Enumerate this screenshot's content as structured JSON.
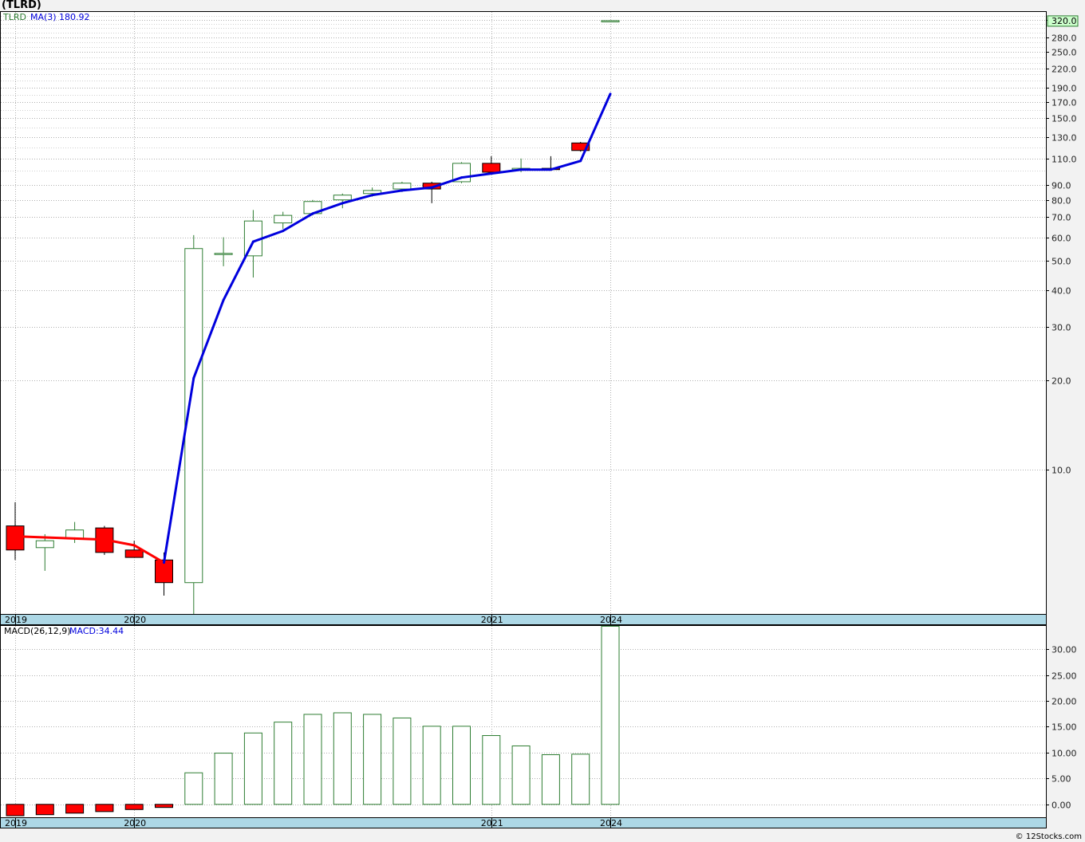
{
  "header": {
    "title": "(TLRD)"
  },
  "price_panel": {
    "symbol": "TLRD",
    "ma_label": "MA(3)",
    "ma_value": "180.92",
    "last_price_badge": "320.0"
  },
  "macd_panel": {
    "label": "MACD(26,12,9)",
    "value_label": "MACD:34.44"
  },
  "footer": {
    "copyright": "© 12Stocks.com"
  },
  "colors": {
    "up_candle": "#2e7d32",
    "down_candle": "#ff0000",
    "ma_up": "#0000dd",
    "ma_down": "#ff0000",
    "axis_band": "#add8e6",
    "badge_bg": "#ccffcc"
  },
  "chart_data": [
    {
      "type": "candlestick",
      "scale": "log",
      "ylim": [
        3.3,
        340
      ],
      "yticks": [
        "10.0",
        "20.0",
        "30.0",
        "40.0",
        "50.0",
        "60.0",
        "70.0",
        "80.0",
        "90.0",
        "110.0",
        "130.0",
        "150.0",
        "170.0",
        "190.0",
        "220.0",
        "250.0",
        "280.0",
        "320.0"
      ],
      "x_axis_labels": [
        {
          "label": "2019",
          "index": 0
        },
        {
          "label": "2020",
          "index": 4
        },
        {
          "label": "2021",
          "index": 16
        },
        {
          "label": "2024",
          "index": 20
        }
      ],
      "candles": [
        {
          "open": 6.5,
          "high": 7.8,
          "low": 5.0,
          "close": 5.4
        },
        {
          "open": 5.5,
          "high": 6.1,
          "low": 4.6,
          "close": 5.8
        },
        {
          "open": 5.9,
          "high": 6.7,
          "low": 5.7,
          "close": 6.3
        },
        {
          "open": 6.4,
          "high": 6.5,
          "low": 5.2,
          "close": 5.3
        },
        {
          "open": 5.4,
          "high": 5.8,
          "low": 5.1,
          "close": 5.1
        },
        {
          "open": 5.0,
          "high": 5.3,
          "low": 3.8,
          "close": 4.2
        },
        {
          "open": 4.2,
          "high": 61,
          "low": 3.3,
          "close": 55
        },
        {
          "open": 53,
          "high": 60,
          "low": 48,
          "close": 53
        },
        {
          "open": 52,
          "high": 74,
          "low": 44,
          "close": 68
        },
        {
          "open": 67,
          "high": 73,
          "low": 64,
          "close": 71
        },
        {
          "open": 72,
          "high": 80,
          "low": 71,
          "close": 79
        },
        {
          "open": 80,
          "high": 84,
          "low": 75,
          "close": 83
        },
        {
          "open": 84,
          "high": 88,
          "low": 82,
          "close": 86
        },
        {
          "open": 87,
          "high": 92,
          "low": 85,
          "close": 91
        },
        {
          "open": 91,
          "high": 92,
          "low": 78,
          "close": 87
        },
        {
          "open": 92,
          "high": 107,
          "low": 91,
          "close": 106
        },
        {
          "open": 106,
          "high": 112,
          "low": 98,
          "close": 99
        },
        {
          "open": 101,
          "high": 110,
          "low": 99,
          "close": 102
        },
        {
          "open": 102,
          "high": 112,
          "low": 101,
          "close": 101
        },
        {
          "open": 124,
          "high": 125,
          "low": 116,
          "close": 117
        },
        {
          "open": 318,
          "high": 319,
          "low": 317,
          "close": 318
        }
      ],
      "ma3": [
        6.0,
        5.95,
        5.9,
        5.85,
        5.6,
        4.9,
        20.3,
        37,
        58,
        63,
        72,
        78,
        83,
        86,
        88,
        95,
        98,
        101,
        101,
        108,
        180.92
      ]
    },
    {
      "type": "bar",
      "title": "MACD(26,12,9)",
      "ylim": [
        -2.5,
        34.5
      ],
      "yticks": [
        "0.00",
        "5.00",
        "10.00",
        "15.00",
        "20.00",
        "25.00",
        "30.00"
      ],
      "values": [
        -2.2,
        -2.0,
        -1.7,
        -1.4,
        -1.0,
        -0.6,
        6.1,
        9.9,
        13.8,
        15.9,
        17.4,
        17.7,
        17.4,
        16.7,
        15.1,
        15.1,
        13.3,
        11.3,
        9.6,
        9.7,
        34.44
      ]
    }
  ]
}
